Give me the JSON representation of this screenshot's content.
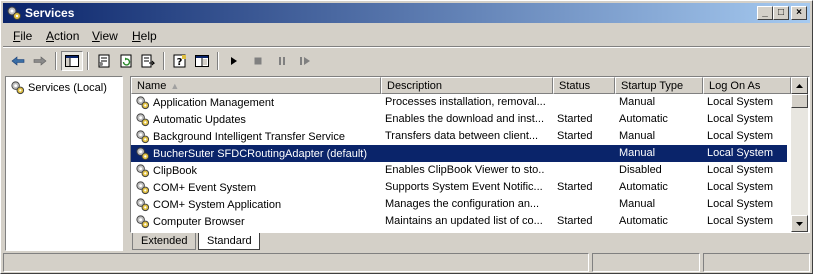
{
  "window": {
    "title": "Services"
  },
  "caption_buttons": {
    "minimize": "_",
    "maximize": "□",
    "close": "×"
  },
  "menu": [
    {
      "label_ul": "F",
      "label_rest": "ile"
    },
    {
      "label_ul": "A",
      "label_rest": "ction"
    },
    {
      "label_ul": "V",
      "label_rest": "iew"
    },
    {
      "label_ul": "H",
      "label_rest": "elp"
    }
  ],
  "toolbar": {
    "icons": [
      "back-arrow-icon",
      "forward-arrow-icon",
      "show-hide-console-tree-icon",
      "properties-icon",
      "refresh-icon",
      "export-list-icon",
      "help-icon",
      "show-action-pane-icon",
      "start-service-icon",
      "stop-service-icon",
      "pause-service-icon",
      "restart-service-icon"
    ]
  },
  "tree": {
    "root": "Services (Local)"
  },
  "table": {
    "columns": [
      "Name",
      "Description",
      "Status",
      "Startup Type",
      "Log On As"
    ],
    "sort_indicator": "▲",
    "rows": [
      {
        "name": "Application Management",
        "description": "Processes installation, removal...",
        "status": "",
        "startup": "Manual",
        "logon": "Local System",
        "selected": false
      },
      {
        "name": "Automatic Updates",
        "description": "Enables the download and inst...",
        "status": "Started",
        "startup": "Automatic",
        "logon": "Local System",
        "selected": false
      },
      {
        "name": "Background Intelligent Transfer Service",
        "description": "Transfers data between client...",
        "status": "Started",
        "startup": "Manual",
        "logon": "Local System",
        "selected": false
      },
      {
        "name": "BucherSuter SFDCRoutingAdapter (default)",
        "description": "",
        "status": "",
        "startup": "Manual",
        "logon": "Local System",
        "selected": true
      },
      {
        "name": "ClipBook",
        "description": "Enables ClipBook Viewer to sto...",
        "status": "",
        "startup": "Disabled",
        "logon": "Local System",
        "selected": false
      },
      {
        "name": "COM+ Event System",
        "description": "Supports System Event Notific...",
        "status": "Started",
        "startup": "Automatic",
        "logon": "Local System",
        "selected": false
      },
      {
        "name": "COM+ System Application",
        "description": "Manages the configuration an...",
        "status": "",
        "startup": "Manual",
        "logon": "Local System",
        "selected": false
      },
      {
        "name": "Computer Browser",
        "description": "Maintains an updated list of co...",
        "status": "Started",
        "startup": "Automatic",
        "logon": "Local System",
        "selected": false
      }
    ]
  },
  "tabs": [
    {
      "label": "Extended",
      "active": false
    },
    {
      "label": "Standard",
      "active": true
    }
  ],
  "colors": {
    "selection": "#0a246a",
    "title_gradient_start": "#0a246a",
    "title_gradient_end": "#a6caf0",
    "face": "#d4d0c8"
  }
}
